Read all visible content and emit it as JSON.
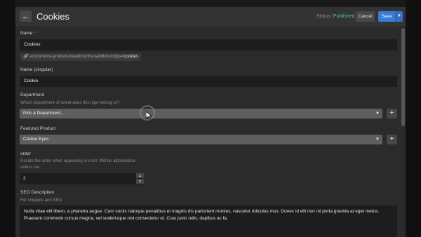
{
  "header": {
    "back_icon": "arrow-left-icon",
    "title": "Cookies",
    "status_label": "Status:",
    "status_value": "Published",
    "cancel_label": "Cancel",
    "save_label": "Save",
    "save_menu_icon": "chevron-down-icon",
    "accent_color": "#3a7bd5",
    "status_color": "#3fcf7b"
  },
  "fields": {
    "name": {
      "label": "Name",
      "required_mark": "*",
      "value": "Cookies"
    },
    "slug": {
      "prefix": "ecommerce-product-breadcrumbs.webflow.io/type/",
      "value": "cookies",
      "icon": "link-icon"
    },
    "name_singular": {
      "label": "Name (singular)",
      "value": "Cookie"
    },
    "department": {
      "label": "Department",
      "help": "Which department of sweet does this type belong to?",
      "value": "Pick a Department...",
      "add_label": "+"
    },
    "featured_product": {
      "label": "Featured Product",
      "value": "Cookie Eyes",
      "add_label": "+"
    },
    "order": {
      "label": "order",
      "help_line1": "Decide the order when appearing in a list. Will be alphabetical",
      "help_line2": "unless set.",
      "value": "2"
    },
    "seo_description": {
      "label": "SEO Description",
      "help": "For snippets and SEO",
      "value": "Nulla vitae elit libero, a pharetra augue. Cum sociis natoque penatibus et magnis dis parturient montes, nascetur ridiculus mus. Donec id elit non mi porta gravida at eget metus. Praesent commodo cursus magna, vel scelerisque nisl consectetur et. Cras justo odio, dapibus ac fa."
    }
  }
}
